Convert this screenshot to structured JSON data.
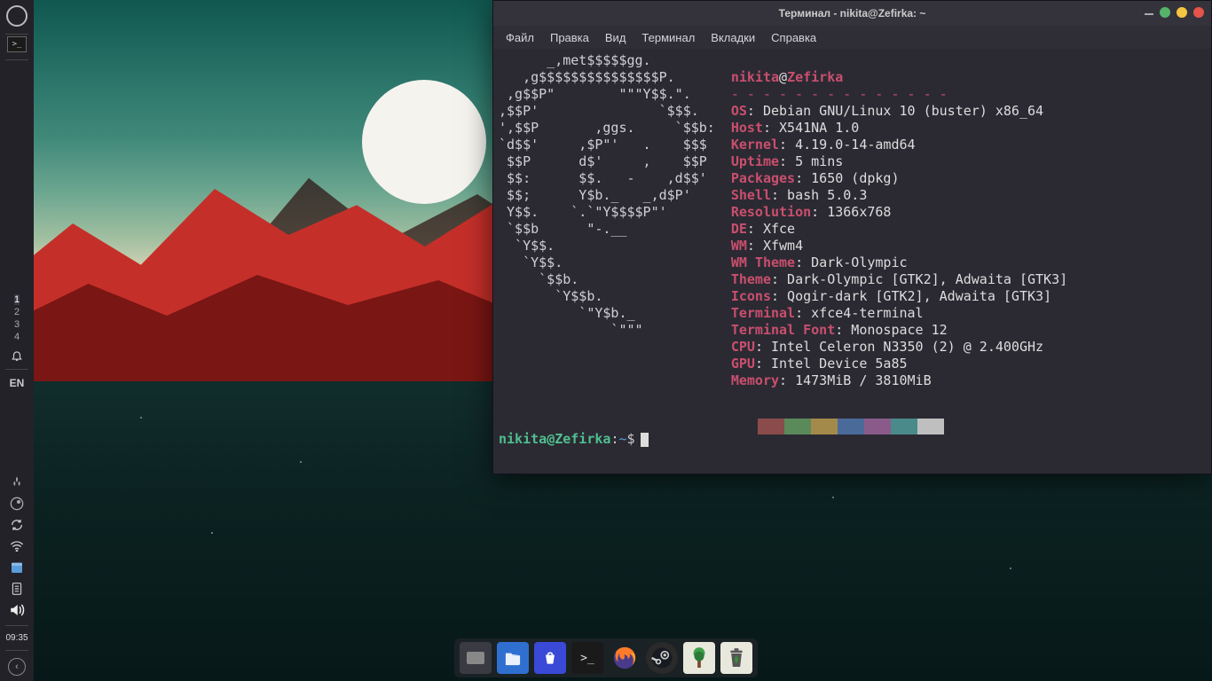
{
  "window": {
    "title": "Терминал - nikita@Zefirka: ~"
  },
  "menubar": [
    "Файл",
    "Правка",
    "Вид",
    "Терминал",
    "Вкладки",
    "Справка"
  ],
  "neofetch": {
    "user": "nikita",
    "at": "@",
    "host": "Zefirka",
    "separator": "- - - - - - - - - - - - - -",
    "ascii": "      _,met$$$$$gg.\n   ,g$$$$$$$$$$$$$$$P.\n ,g$$P\"        \"\"\"Y$$.\".\n,$$P'               `$$$.\n',$$P       ,ggs.     `$$b:\n`d$$'     ,$P\"'   .    $$$\n $$P      d$'     ,    $$P\n $$:      $$.   -    ,d$$'\n $$;      Y$b._   _,d$P'\n Y$$.    `.`\"Y$$$$P\"'\n `$$b      \"-.__\n  `Y$$.\n   `Y$$.\n     `$$b.\n       `Y$$b.\n          `\"Y$b._\n              `\"\"\"",
    "rows": [
      {
        "label": "OS",
        "value": "Debian GNU/Linux 10 (buster) x86_64"
      },
      {
        "label": "Host",
        "value": "X541NA 1.0"
      },
      {
        "label": "Kernel",
        "value": "4.19.0-14-amd64"
      },
      {
        "label": "Uptime",
        "value": "5 mins"
      },
      {
        "label": "Packages",
        "value": "1650 (dpkg)"
      },
      {
        "label": "Shell",
        "value": "bash 5.0.3"
      },
      {
        "label": "Resolution",
        "value": "1366x768"
      },
      {
        "label": "DE",
        "value": "Xfce"
      },
      {
        "label": "WM",
        "value": "Xfwm4"
      },
      {
        "label": "WM Theme",
        "value": "Dark-Olympic"
      },
      {
        "label": "Theme",
        "value": "Dark-Olympic [GTK2], Adwaita [GTK3]"
      },
      {
        "label": "Icons",
        "value": "Qogir-dark [GTK2], Adwaita [GTK3]"
      },
      {
        "label": "Terminal",
        "value": "xfce4-terminal"
      },
      {
        "label": "Terminal Font",
        "value": "Monospace 12"
      },
      {
        "label": "CPU",
        "value": "Intel Celeron N3350 (2) @ 2.400GHz"
      },
      {
        "label": "GPU",
        "value": "Intel Device 5a85"
      },
      {
        "label": "Memory",
        "value": "1473MiB / 3810MiB"
      }
    ],
    "swatches": [
      "#2b2a33",
      "#8a4b4b",
      "#5a8a5a",
      "#a38a4a",
      "#4a6a9a",
      "#8a5a8a",
      "#4a8a8a",
      "#bfbfbf",
      "#555",
      "#d47a7a",
      "#7fd47f",
      "#d4c47a",
      "#7a9ad4",
      "#d47ad4",
      "#7ad4d4",
      "#efefef"
    ]
  },
  "prompt": {
    "user": "nikita",
    "at": "@",
    "host": "Zefirka",
    "colon": ":",
    "path": "~",
    "symbol": "$"
  },
  "left_dock": {
    "terminal_small": ">_",
    "workspaces": [
      "1",
      "2",
      "3",
      "4"
    ],
    "active_workspace": 0,
    "language": "EN",
    "clock": "09:35"
  },
  "bottom_dock": {
    "items": [
      "files-app",
      "file-manager",
      "software-center",
      "terminal",
      "firefox",
      "steam",
      "game",
      "trash"
    ]
  },
  "window_controls": {
    "min": "#aaaaaa",
    "max": "#f5c542",
    "close": "#e5534b",
    "extra": "#55b36a"
  }
}
